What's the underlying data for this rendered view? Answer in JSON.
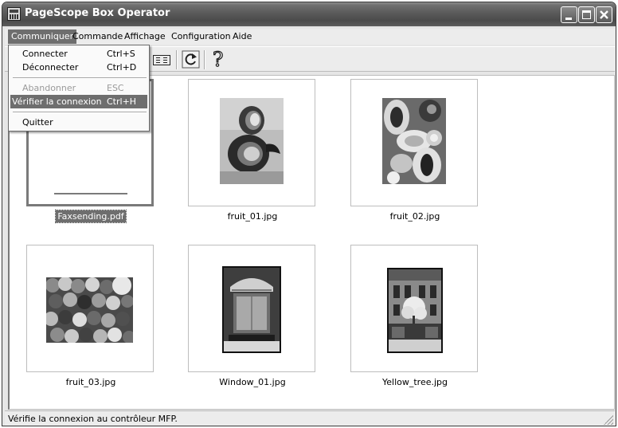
{
  "window": {
    "title": "PageScope Box Operator"
  },
  "menubar": {
    "communiquer": "Communiquer",
    "commande": "Commande",
    "affichage": "Affichage",
    "configuration": "Configuration",
    "aide": "Aide"
  },
  "dropdown": {
    "items": [
      {
        "label": "Connecter",
        "shortcut": "Ctrl+S",
        "state": "enabled"
      },
      {
        "label": "Déconnecter",
        "shortcut": "Ctrl+D",
        "state": "enabled"
      },
      {
        "label": "Abandonner",
        "shortcut": "ESC",
        "state": "disabled"
      },
      {
        "label": "Vérifier la connexion",
        "shortcut": "Ctrl+H",
        "state": "highlighted"
      },
      {
        "label": "Quitter",
        "shortcut": "",
        "state": "enabled"
      }
    ]
  },
  "toolbar": {
    "help_glyph": "?"
  },
  "files": [
    {
      "name": "Faxsending.pdf",
      "selected": true
    },
    {
      "name": "fruit_01.jpg",
      "selected": false
    },
    {
      "name": "fruit_02.jpg",
      "selected": false
    },
    {
      "name": "fruit_03.jpg",
      "selected": false
    },
    {
      "name": "Window_01.jpg",
      "selected": false
    },
    {
      "name": "Yellow_tree.jpg",
      "selected": false
    }
  ],
  "statusbar": {
    "text": "Vérifie la connexion au contrôleur MFP."
  }
}
